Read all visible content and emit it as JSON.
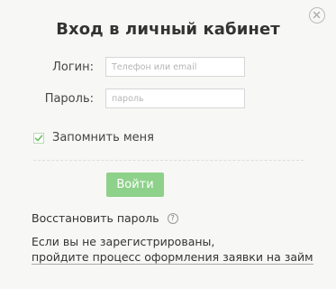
{
  "dialog": {
    "title": "Вход в личный кабинет",
    "close_icon": "close-circle-icon"
  },
  "form": {
    "login_label": "Логин:",
    "login_placeholder": "Телефон или email",
    "login_value": "",
    "password_label": "Пароль:",
    "password_placeholder": "пароль",
    "password_value": "",
    "remember_label": "Запомнить меня",
    "remember_checked": true,
    "submit_label": "Войти"
  },
  "links": {
    "restore_password": "Восстановить пароль",
    "help_icon": "question-circle-icon",
    "not_registered": "Если вы не зарегистрированы,",
    "apply_link": "пройдите процесс оформления заявки на займ"
  },
  "colors": {
    "submit_bg": "#8ed18a",
    "check_color": "#6cbf66",
    "background": "#f7f7f6"
  }
}
